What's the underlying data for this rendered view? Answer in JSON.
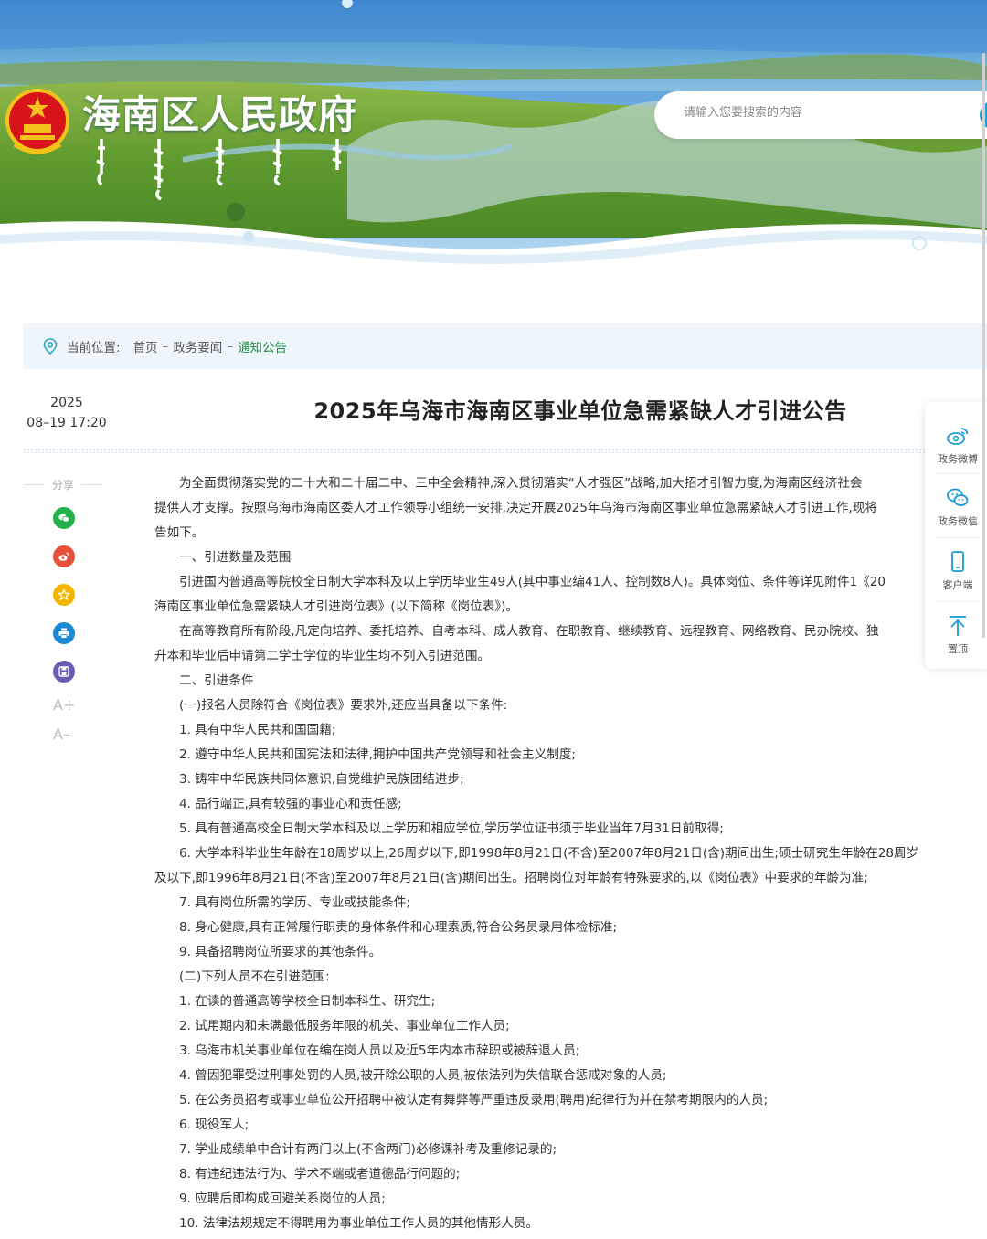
{
  "header": {
    "site_title": "海南区人民政府",
    "search_placeholder": "请输入您要搜索的内容",
    "emblem_icon": "national-emblem-icon"
  },
  "breadcrumb": {
    "label": "当前位置:",
    "items": [
      "首页",
      "政务要闻",
      "通知公告"
    ],
    "separator": "–"
  },
  "article": {
    "date_year": "2025",
    "date_time": "08–19 17:20",
    "title": "2025年乌海市海南区事业单位急需紧缺人才引进公告"
  },
  "share": {
    "label": "分享",
    "icons": [
      "wechat-icon",
      "weibo-icon",
      "favorite-icon",
      "print-icon",
      "save-icon"
    ],
    "font_larger": "A+",
    "font_smaller": "A–"
  },
  "body": {
    "p1a": "为全面贯彻落实党的二十大和二十届二中、三中全会精神,深入贯彻落实“人才强区”战略,加大招才引智力度,为海南区经济社会",
    "p1b": "提供人才支撑。按照乌海市海南区委人才工作领导小组统一安排,决定开展2025年乌海市海南区事业单位急需紧缺人才引进工作,现将",
    "p1c": "告如下。",
    "h1": "一、引进数量及范围",
    "p2a": "引进国内普通高等院校全日制大学本科及以上学历毕业生49人(其中事业编41人、控制数8人)。具体岗位、条件等详见附件1《20",
    "p2b": "海南区事业单位急需紧缺人才引进岗位表》(以下简称《岗位表》)。",
    "p3a": "在高等教育所有阶段,凡定向培养、委托培养、自考本科、成人教育、在职教育、继续教育、远程教育、网络教育、民办院校、独",
    "p3b": "升本和毕业后申请第二学士学位的毕业生均不列入引进范围。",
    "h2": "二、引进条件",
    "s1": "(一)报名人员除符合《岗位表》要求外,还应当具备以下条件:",
    "c1": "1. 具有中华人民共和国国籍;",
    "c2": "2. 遵守中华人民共和国宪法和法律,拥护中国共产党领导和社会主义制度;",
    "c3": "3. 铸牢中华民族共同体意识,自觉维护民族团结进步;",
    "c4": "4. 品行端正,具有较强的事业心和责任感;",
    "c5": "5. 具有普通高校全日制大学本科及以上学历和相应学位,学历学位证书须于毕业当年7月31日前取得;",
    "c6a": "6. 大学本科毕业生年龄在18周岁以上,26周岁以下,即1998年8月21日(不含)至2007年8月21日(含)期间出生;硕士研究生年龄在28周岁",
    "c6b": "及以下,即1996年8月21日(不含)至2007年8月21日(含)期间出生。招聘岗位对年龄有特殊要求的,以《岗位表》中要求的年龄为准;",
    "c7": "7. 具有岗位所需的学历、专业或技能条件;",
    "c8": "8. 身心健康,具有正常履行职责的身体条件和心理素质,符合公务员录用体检标准;",
    "c9": "9. 具备招聘岗位所要求的其他条件。",
    "s2": "(二)下列人员不在引进范围:",
    "e1": "1. 在读的普通高等学校全日制本科生、研究生;",
    "e2": "2. 试用期内和未满最低服务年限的机关、事业单位工作人员;",
    "e3": "3. 乌海市机关事业单位在编在岗人员以及近5年内本市辞职或被辞退人员;",
    "e4": "4. 曾因犯罪受过刑事处罚的人员,被开除公职的人员,被依法列为失信联合惩戒对象的人员;",
    "e5": "5. 在公务员招考或事业单位公开招聘中被认定有舞弊等严重违反录用(聘用)纪律行为并在禁考期限内的人员;",
    "e6": "6. 现役军人;",
    "e7": "7. 学业成绩单中合计有两门以上(不含两门)必修课补考及重修记录的;",
    "e8": "8. 有违纪违法行为、学术不端或者道德品行问题的;",
    "e9": "9. 应聘后即构成回避关系岗位的人员;",
    "e10": "10. 法律法规规定不得聘用为事业单位工作人员的其他情形人员。"
  },
  "sidebar": {
    "items": [
      {
        "label": "政务微博",
        "icon": "weibo-icon"
      },
      {
        "label": "政务微信",
        "icon": "wechat-icon"
      },
      {
        "label": "客户端",
        "icon": "mobile-icon"
      },
      {
        "label": "置顶",
        "icon": "back-to-top-icon"
      }
    ]
  },
  "colors": {
    "accent_green": "#1a8f3f",
    "breadcrumb_bg": "#eef6fb",
    "wechat": "#22b14c",
    "weibo": "#e8503a",
    "favorite": "#f5b400",
    "print": "#1a8ad6",
    "save": "#6a5bb3"
  }
}
